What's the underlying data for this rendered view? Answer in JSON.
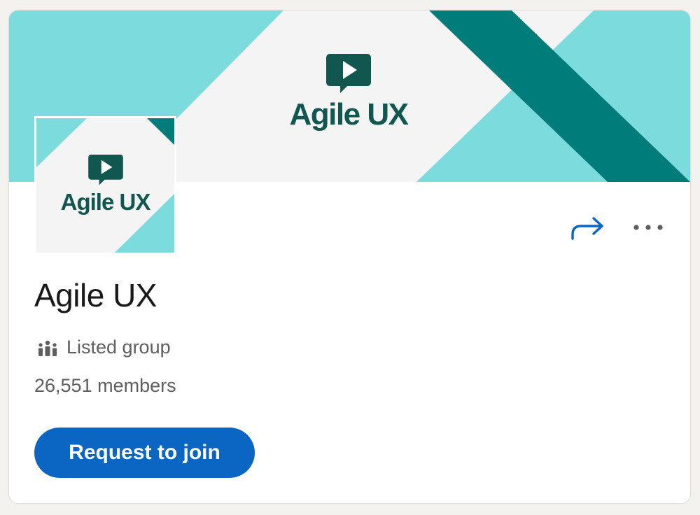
{
  "banner": {
    "logo_text": "Agile UX",
    "logo_icon": "play-speech-bubble-icon"
  },
  "avatar": {
    "logo_text": "Agile UX",
    "logo_icon": "play-speech-bubble-icon"
  },
  "actions": {
    "share_icon": "share-arrow-icon",
    "more_icon": "more-dots-icon"
  },
  "group": {
    "name": "Agile UX",
    "privacy_icon": "group-people-icon",
    "privacy": "Listed group",
    "members": "26,551 members"
  },
  "join_button": {
    "label": "Request to join"
  },
  "colors": {
    "teal_light": "#7bdbdd",
    "teal_dark": "#007c7a",
    "logo_dark": "#11564f",
    "link_blue": "#0a66c2",
    "text_primary": "#191919",
    "text_secondary": "#5e5e5e"
  }
}
